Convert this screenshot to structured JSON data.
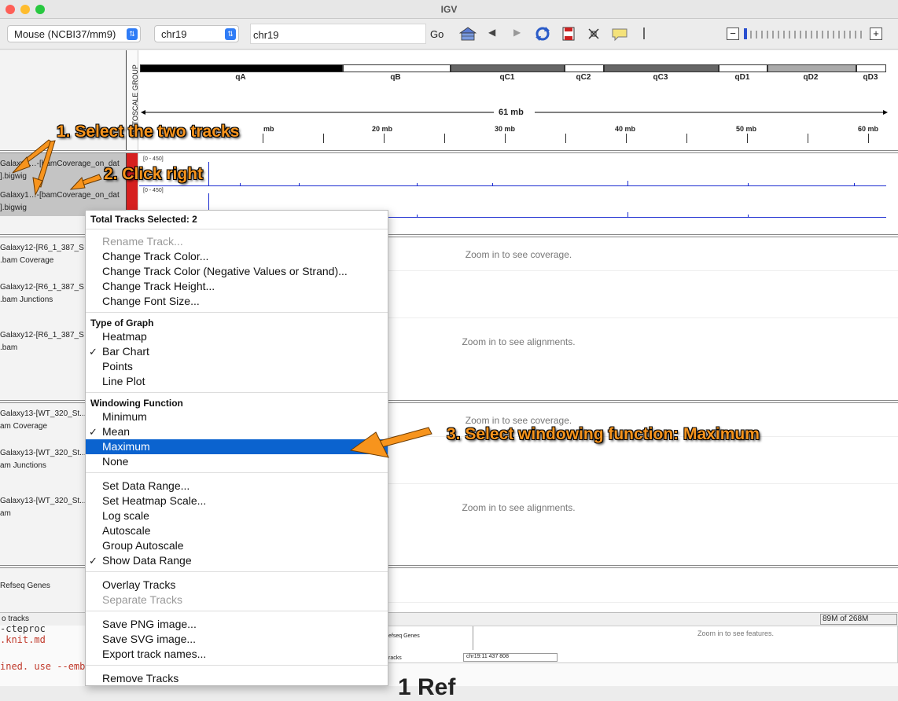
{
  "window": {
    "title": "IGV"
  },
  "toolbar": {
    "genome": "Mouse (NCBI37/mm9)",
    "chromosome": "chr19",
    "locus": "chr19",
    "go_label": "Go",
    "zoom_minus": "−",
    "zoom_plus": "+"
  },
  "ideogram": {
    "attr_header": "AUTOSCALE GROUP",
    "bands": [
      "qA",
      "qB",
      "qC1",
      "qC2",
      "qC3",
      "qD1",
      "qD2",
      "qD3"
    ],
    "span_label": "61 mb",
    "ticks": [
      "mb",
      "20 mb",
      "30 mb",
      "40 mb",
      "50 mb",
      "60 mb"
    ]
  },
  "tracks": {
    "bigwig1_name": "Galaxy1…-[bamCoverage_on_dat",
    "bigwig1_sub": "].bigwig",
    "bigwig2_name": "Galaxy1…-[bamCoverage_on_dat",
    "bigwig2_sub": "].bigwig",
    "range": "[0 - 450]",
    "g12_cov": "Galaxy12-[R6_1_387_S",
    "g12_cov_sub": ".bam Coverage",
    "g12_junc": "Galaxy12-[R6_1_387_S",
    "g12_junc_sub": ".bam Junctions",
    "g12_bam": "Galaxy12-[R6_1_387_S",
    "g12_bam_sub": ".bam",
    "g13_cov": "Galaxy13-[WT_320_St...",
    "g13_cov_sub": "am Coverage",
    "g13_junc": "Galaxy13-[WT_320_St...",
    "g13_junc_sub": "am Junctions",
    "g13_bam": "Galaxy13-[WT_320_St...",
    "g13_bam_sub": "am",
    "refseq": "Refseq Genes",
    "zoom_coverage": "Zoom in to see coverage.",
    "zoom_alignments": "Zoom in to see alignments."
  },
  "status": {
    "tracks": "o tracks",
    "memory": "89M of 268M"
  },
  "background": {
    "code1": "-cteproc",
    "code2": ".knit.md",
    "code3": "ined. use --embe",
    "mini_refseq": "efseq Genes",
    "mini_zoom": "Zoom in to see features.",
    "mini_tracks": "racks",
    "mini_locus": "chr19:11 437 808",
    "big_text": "1 Ref"
  },
  "menu": {
    "header": "Total Tracks Selected: 2",
    "rename": "Rename Track...",
    "change_color": "Change Track Color...",
    "change_color_neg": "Change Track Color (Negative Values or Strand)...",
    "change_height": "Change Track Height...",
    "change_font": "Change Font Size...",
    "graph_header": "Type of Graph",
    "heatmap": "Heatmap",
    "bar_chart": "Bar Chart",
    "points": "Points",
    "line_plot": "Line Plot",
    "window_header": "Windowing Function",
    "minimum": "Minimum",
    "mean": "Mean",
    "maximum": "Maximum",
    "none": "None",
    "set_range": "Set Data Range...",
    "set_heatmap": "Set Heatmap Scale...",
    "log_scale": "Log scale",
    "autoscale": "Autoscale",
    "group_autoscale": "Group Autoscale",
    "show_range": "Show Data Range",
    "overlay": "Overlay Tracks",
    "separate": "Separate Tracks",
    "save_png": "Save PNG image...",
    "save_svg": "Save SVG image...",
    "export_names": "Export track names...",
    "remove": "Remove Tracks",
    "check": "✓"
  },
  "annotations": {
    "step1": "1. Select the two tracks",
    "step2": "2. Click right",
    "step3": "3. Select windowing function: Maximum"
  },
  "colors": {
    "highlight": "#0b63cf",
    "annotation": "#f7941d",
    "coverage": "#1a2bd0"
  }
}
